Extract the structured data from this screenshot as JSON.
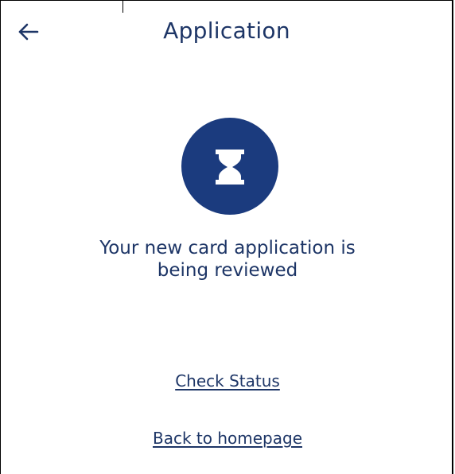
{
  "header": {
    "title": "Application",
    "back_icon": "arrow-left-icon"
  },
  "status": {
    "icon": "hourglass-icon",
    "circle_color": "#1b3b7e",
    "message_line1": "Your new card application is",
    "message_line2": "being reviewed"
  },
  "actions": {
    "check_status": "Check Status",
    "back_home": "Back to homepage"
  },
  "colors": {
    "primary": "#1d3566",
    "background": "#ffffff"
  }
}
